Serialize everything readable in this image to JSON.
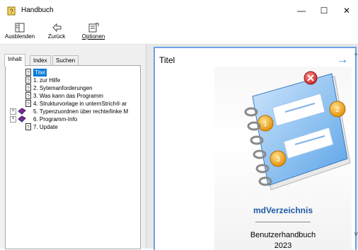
{
  "window": {
    "title": "Handbuch",
    "minimize": "—",
    "maximize": "☐",
    "close": "✕"
  },
  "toolbar": {
    "hide_label": "Ausblenden",
    "back_label": "Zurück",
    "options_label": "Optionen"
  },
  "tabs": {
    "contents": "Inhalt",
    "index": "Index",
    "search": "Suchen"
  },
  "tree": {
    "items": [
      {
        "label": "Titel",
        "kind": "page",
        "selected": true
      },
      {
        "label": "1. zur Hilfe",
        "kind": "page"
      },
      {
        "label": "2. Sytemanforderungen",
        "kind": "page"
      },
      {
        "label": "3. Was kann das Programm",
        "kind": "page"
      },
      {
        "label": "4. Strukturvorlage in unternStrich® ar",
        "kind": "page"
      },
      {
        "label": "5. Typenzuordnen über rechte/linke M",
        "kind": "book"
      },
      {
        "label": "6. Programm-Info",
        "kind": "book"
      },
      {
        "label": "7. Update",
        "kind": "page"
      }
    ]
  },
  "content": {
    "heading": "Titel",
    "arrow": "→",
    "cover_title": "mdVerzeichnis",
    "cover_subtitle": "Benutzerhandbuch",
    "cover_year": "2023"
  },
  "colors": {
    "accent": "#2f7fd8",
    "selection": "#0078d7",
    "cover_title": "#1f5aa6",
    "frame_border": "#6aa3e6"
  }
}
